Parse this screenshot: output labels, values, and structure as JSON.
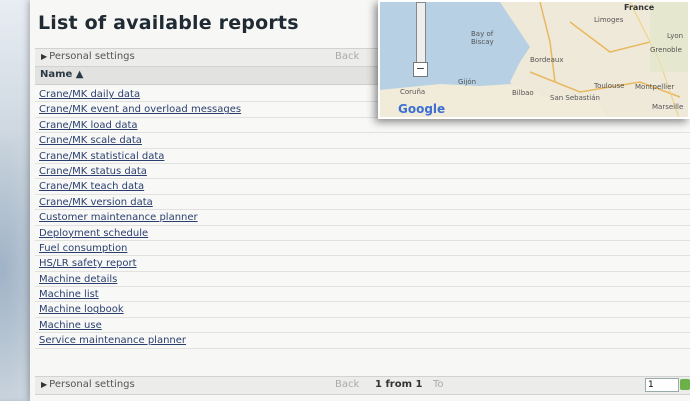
{
  "title": "List of available reports",
  "settings_bar": {
    "label": "Personal settings",
    "back": "Back"
  },
  "column_header": "Name ▲",
  "reports": [
    "Crane/MK daily data",
    "Crane/MK event and overload messages",
    "Crane/MK load data",
    "Crane/MK scale data",
    "Crane/MK statistical data",
    "Crane/MK status data",
    "Crane/MK teach data",
    "Crane/MK version data",
    "Customer maintenance planner",
    "Deployment schedule",
    "Fuel consumption",
    "HS/LR safety report",
    "Machine details",
    "Machine list",
    "Machine logbook",
    "Machine use",
    "Service maintenance planner"
  ],
  "footer": {
    "label": "Personal settings",
    "back": "Back",
    "page": "1 from 1",
    "to": "To",
    "page_input": "1"
  },
  "map": {
    "labels": {
      "france": "France",
      "limoges": "Limoges",
      "lyon": "Lyon",
      "grenoble": "Grenoble",
      "bay_of_biscay": "Bay of\nBiscay",
      "bordeaux": "Bordeaux",
      "gijon": "Gijón",
      "toulouse": "Toulouse",
      "montpellier": "Montpellier",
      "marseille": "Marseille",
      "coruna": "Coruña",
      "bilbao": "Bilbao",
      "san_sebastian": "San Sebastián",
      "brand": "Google"
    }
  }
}
